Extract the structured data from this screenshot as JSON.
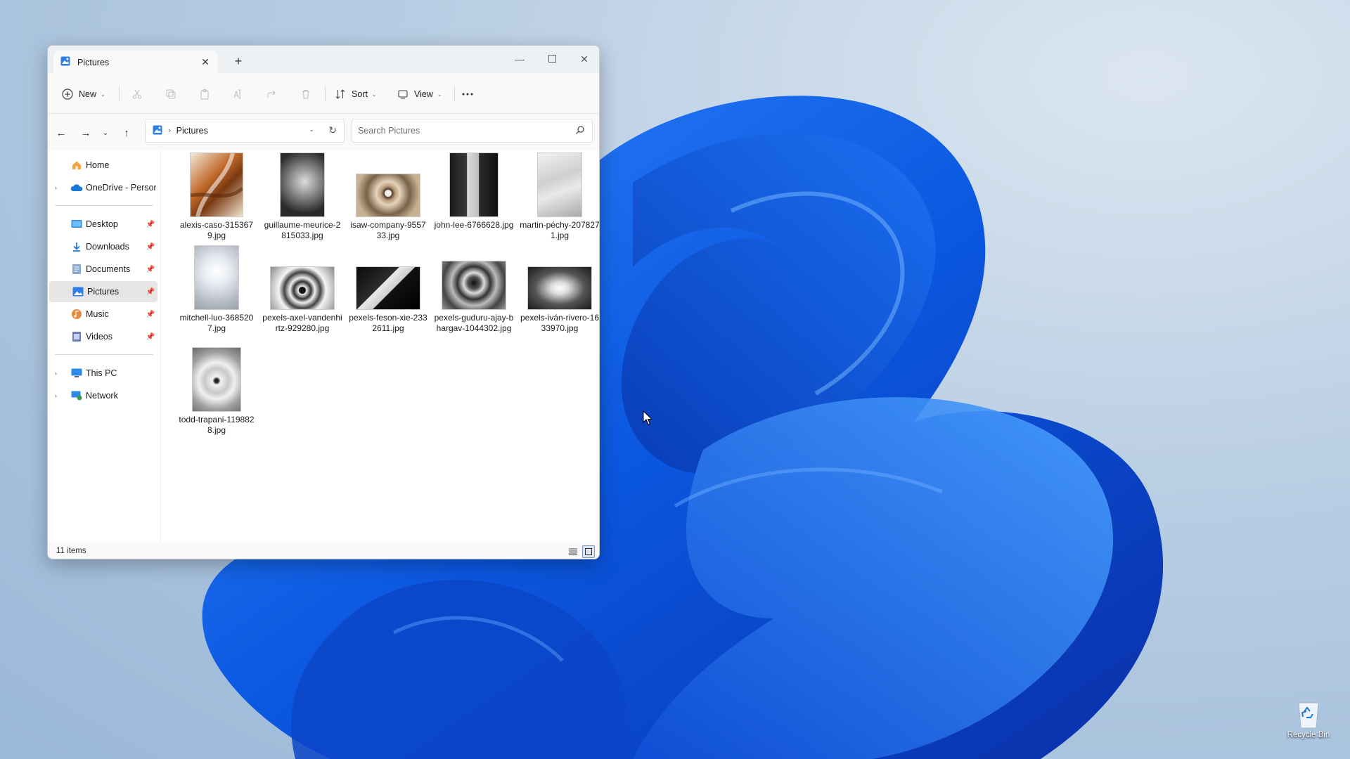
{
  "window": {
    "tab_title": "Pictures",
    "toolbar": {
      "new_label": "New",
      "sort_label": "Sort",
      "view_label": "View"
    },
    "address": {
      "crumb": "Pictures"
    },
    "search": {
      "placeholder": "Search Pictures"
    },
    "sidebar": {
      "items": [
        {
          "label": "Home",
          "icon": "home-icon"
        },
        {
          "label": "OneDrive - Persona",
          "icon": "onedrive-icon"
        },
        {
          "label": "Desktop",
          "icon": "desktop-folder-icon"
        },
        {
          "label": "Downloads",
          "icon": "downloads-icon"
        },
        {
          "label": "Documents",
          "icon": "documents-icon"
        },
        {
          "label": "Pictures",
          "icon": "pictures-icon",
          "selected": true
        },
        {
          "label": "Music",
          "icon": "music-icon"
        },
        {
          "label": "Videos",
          "icon": "videos-icon"
        },
        {
          "label": "This PC",
          "icon": "this-pc-icon"
        },
        {
          "label": "Network",
          "icon": "network-icon"
        }
      ]
    },
    "files": [
      {
        "name": "alexis-caso-3153679.jpg"
      },
      {
        "name": "guillaume-meurice-2815033.jpg"
      },
      {
        "name": "isaw-company-955733.jpg"
      },
      {
        "name": "john-lee-6766628.jpg"
      },
      {
        "name": "martin-péchy-2078271.jpg"
      },
      {
        "name": "mitchell-luo-3685207.jpg"
      },
      {
        "name": "pexels-axel-vandenhirtz-929280.jpg"
      },
      {
        "name": "pexels-feson-xie-2332611.jpg"
      },
      {
        "name": "pexels-guduru-ajay-bhargav-1044302.jpg"
      },
      {
        "name": "pexels-iván-rivero-1633970.jpg"
      },
      {
        "name": "todd-trapani-1198828.jpg"
      }
    ],
    "status": {
      "item_count": "11 items"
    }
  },
  "desktop": {
    "recycle_bin_label": "Recycle Bin"
  },
  "colors": {
    "wallpaper_blue": "#1560e8",
    "accent": "#0067c0",
    "selection": "#e6e6e6"
  }
}
